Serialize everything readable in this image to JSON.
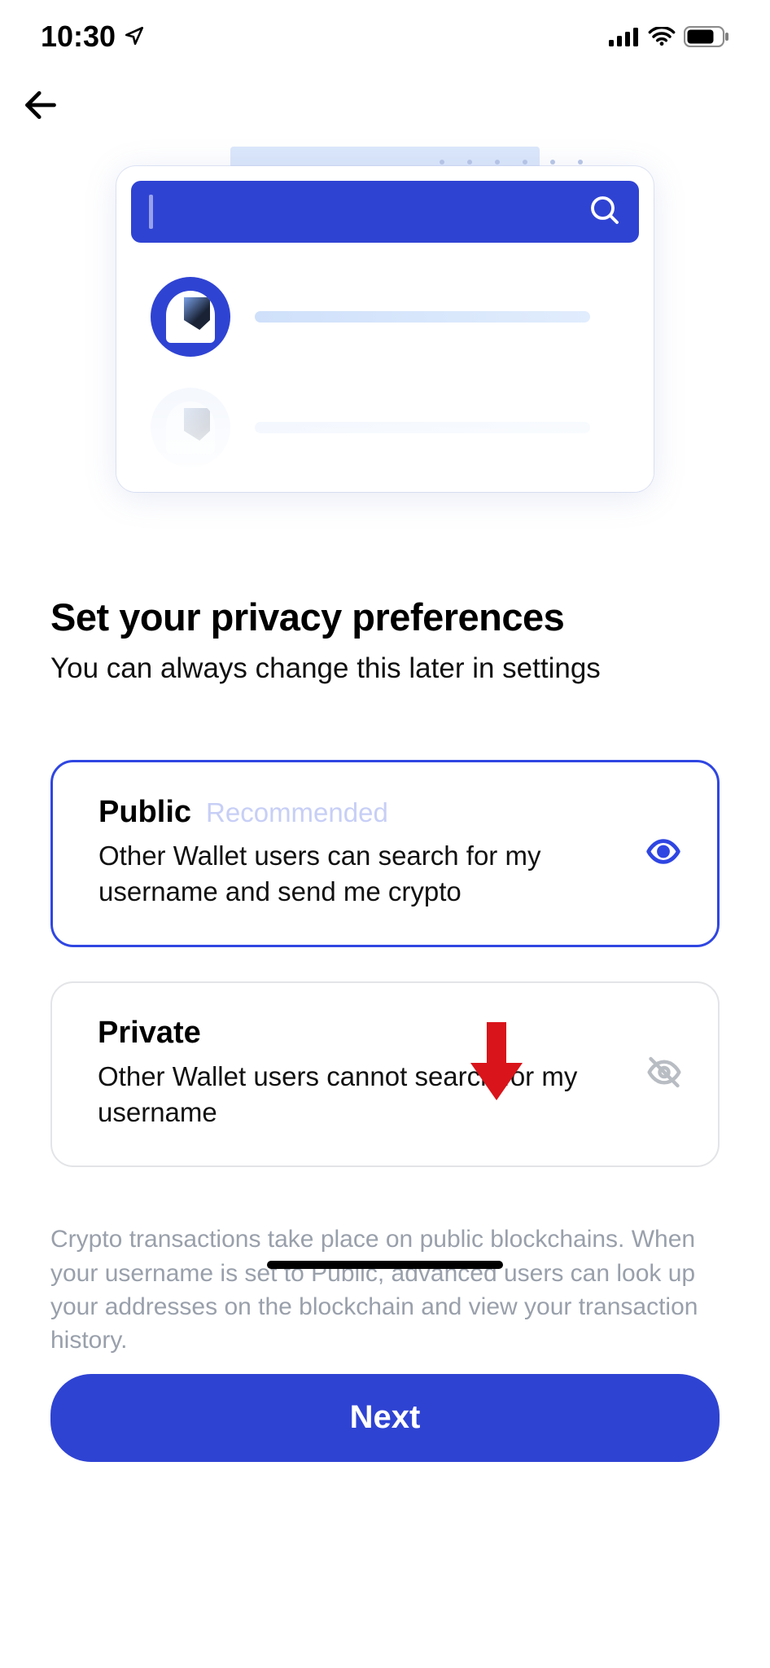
{
  "statusbar": {
    "time": "10:30"
  },
  "heading": "Set your privacy preferences",
  "subheading": "You can always change this later in settings",
  "options": {
    "public": {
      "title": "Public",
      "badge": "Recommended",
      "desc": "Other Wallet users can search for my username and send me crypto",
      "selected": true
    },
    "private": {
      "title": "Private",
      "desc": "Other Wallet users cannot search for my username",
      "selected": false
    }
  },
  "disclaimer": "Crypto transactions take place on public blockchains. When your username is set to Public, advanced users can look up your addresses on the blockchain and view your transaction history.",
  "primary_button": "Next"
}
